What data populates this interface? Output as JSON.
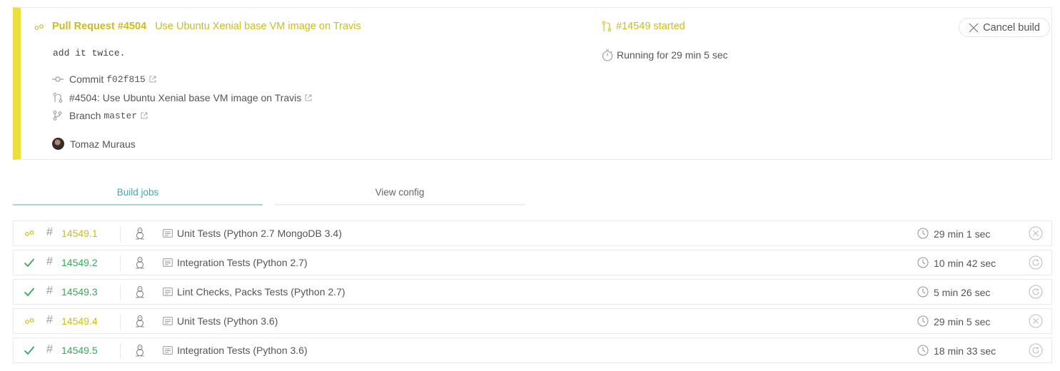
{
  "build": {
    "pr_label": "Pull Request #4504",
    "title": "Use Ubuntu Xenial base VM image on Travis",
    "commit_message": "add it twice.",
    "commit_label": "Commit",
    "commit_sha": "f02f815",
    "pr_link": "#4504: Use Ubuntu Xenial base VM image on Travis",
    "branch_label": "Branch",
    "branch_name": "master",
    "author": "Tomaz Muraus",
    "build_number": "#14549 started",
    "running": "Running for 29 min 5 sec",
    "cancel_label": "Cancel build",
    "status_color": "#edde3f"
  },
  "tabs": {
    "build_jobs": "Build jobs",
    "view_config": "View config"
  },
  "jobs": [
    {
      "status": "running",
      "number": "14549.1",
      "name": "Unit Tests (Python 2.7 MongoDB 3.4)",
      "duration": "29 min 1 sec",
      "action": "cancel"
    },
    {
      "status": "passed",
      "number": "14549.2",
      "name": "Integration Tests (Python 2.7)",
      "duration": "10 min 42 sec",
      "action": "restart"
    },
    {
      "status": "passed",
      "number": "14549.3",
      "name": "Lint Checks, Packs Tests (Python 2.7)",
      "duration": "5 min 26 sec",
      "action": "restart"
    },
    {
      "status": "running",
      "number": "14549.4",
      "name": "Unit Tests (Python 3.6)",
      "duration": "29 min 5 sec",
      "action": "cancel"
    },
    {
      "status": "passed",
      "number": "14549.5",
      "name": "Integration Tests (Python 3.6)",
      "duration": "18 min 33 sec",
      "action": "restart"
    }
  ],
  "colors": {
    "running": "#cdbc1c",
    "passed": "#39aa56",
    "tab_active": "#3eaaaf"
  }
}
